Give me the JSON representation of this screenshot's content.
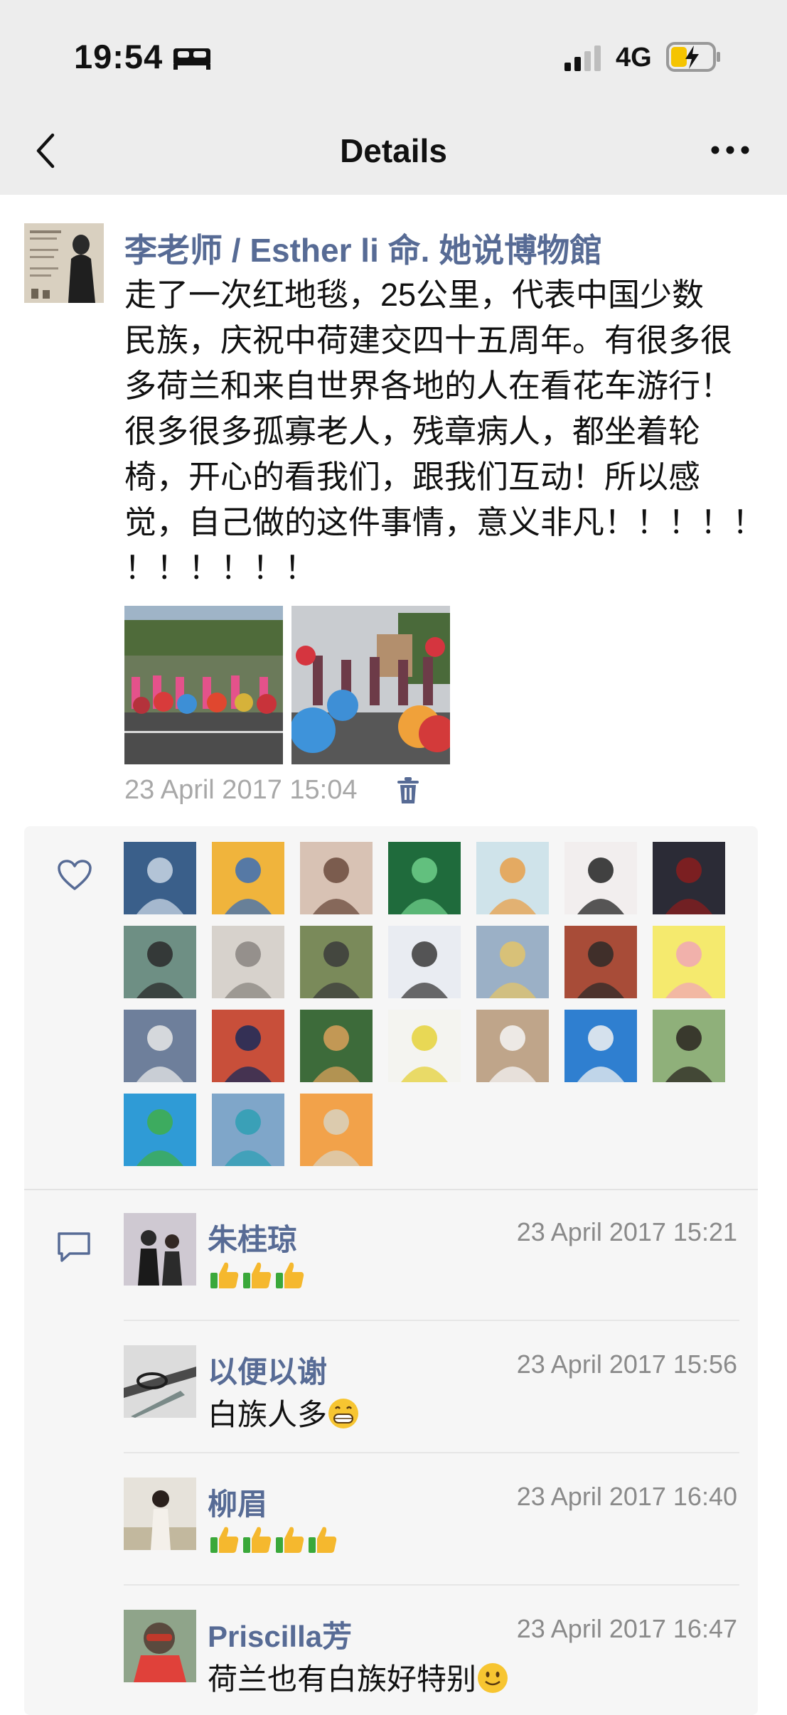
{
  "status_bar": {
    "time": "19:54",
    "network": "4G"
  },
  "nav": {
    "title": "Details"
  },
  "post": {
    "author": "李老师 / Esther li 命. 她说博物館",
    "text": "走了一次红地毯，25公里，代表中国少数\n民族，庆祝中荷建交四十五周年。有很多很\n多荷兰和来自世界各地的人在看花车游行！\n很多很多孤寡老人，残章病人，都坐着轮\n椅，开心的看我们，跟我们互动！所以感\n觉，自己做的这件事情，意义非凡！！！！！\n！！！！！！",
    "time": "23 April 2017 15:04"
  },
  "comments": [
    {
      "name": "朱桂琼",
      "time": "23 April 2017 15:21",
      "text": "",
      "emoji": [
        "thumbs-up",
        "thumbs-up",
        "thumbs-up"
      ]
    },
    {
      "name": "以便以谢",
      "time": "23 April 2017 15:56",
      "text": "白族人多",
      "emoji": [
        "grin"
      ]
    },
    {
      "name": "柳眉",
      "time": "23 April 2017 16:40",
      "text": "",
      "emoji": [
        "thumbs-up",
        "thumbs-up",
        "thumbs-up",
        "thumbs-up"
      ]
    },
    {
      "name": "Priscilla芳",
      "time": "23 April 2017 16:47",
      "text": "荷兰也有白族好特别",
      "emoji": [
        "smile"
      ]
    }
  ],
  "colors": {
    "link": "#576b95",
    "top_bar": "#ededed",
    "panel": "#f6f6f6",
    "meta": "#a8a8a8"
  }
}
